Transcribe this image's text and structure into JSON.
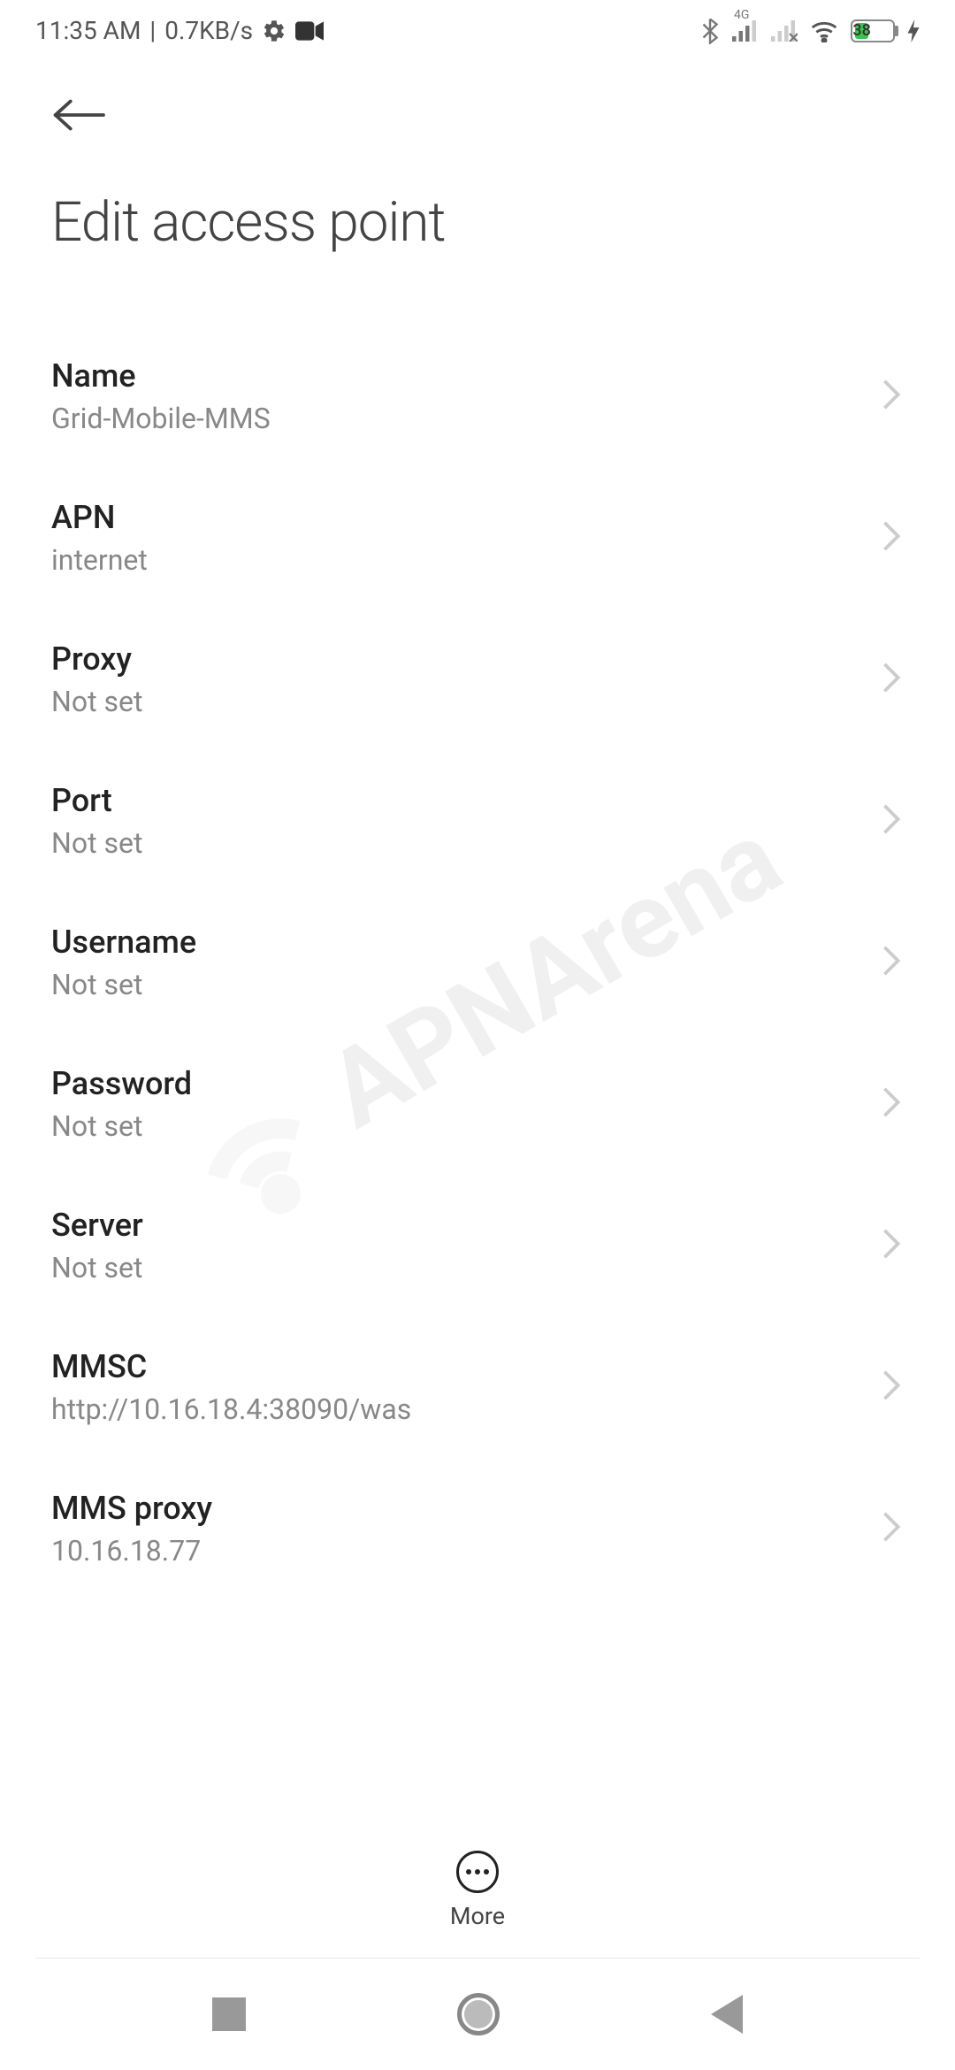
{
  "statusbar": {
    "time": "11:35 AM",
    "data_rate": "0.7KB/s",
    "network_label": "4G",
    "battery_pct": "38"
  },
  "header": {
    "title": "Edit access point"
  },
  "settings": [
    {
      "label": "Name",
      "value": "Grid-Mobile-MMS"
    },
    {
      "label": "APN",
      "value": "internet"
    },
    {
      "label": "Proxy",
      "value": "Not set"
    },
    {
      "label": "Port",
      "value": "Not set"
    },
    {
      "label": "Username",
      "value": "Not set"
    },
    {
      "label": "Password",
      "value": "Not set"
    },
    {
      "label": "Server",
      "value": "Not set"
    },
    {
      "label": "MMSC",
      "value": "http://10.16.18.4:38090/was"
    },
    {
      "label": "MMS proxy",
      "value": "10.16.18.77"
    }
  ],
  "toolbar": {
    "more_label": "More"
  },
  "watermark": {
    "text": "APNArena"
  }
}
